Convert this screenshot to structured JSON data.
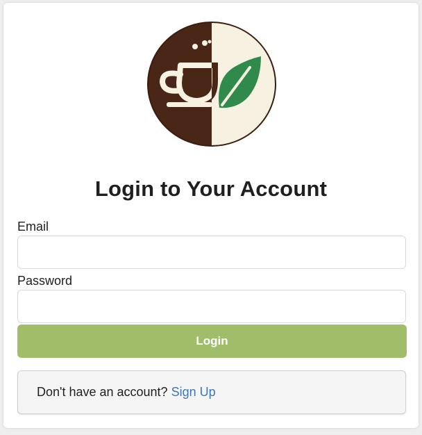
{
  "logo": {
    "icon": "coffee-cup-leaf-logo",
    "colors": {
      "dark": "#4a2616",
      "light": "#f6f1e0",
      "leaf": "#2f8a4c"
    }
  },
  "title": "Login to Your Account",
  "form": {
    "email_label": "Email",
    "email_value": "",
    "email_placeholder": "",
    "password_label": "Password",
    "password_value": "",
    "password_placeholder": "",
    "login_label": "Login"
  },
  "signup": {
    "prompt": "Don't have an account?",
    "link_label": "Sign Up"
  },
  "colors": {
    "accent": "#a0be6a",
    "link": "#3f76b0"
  }
}
